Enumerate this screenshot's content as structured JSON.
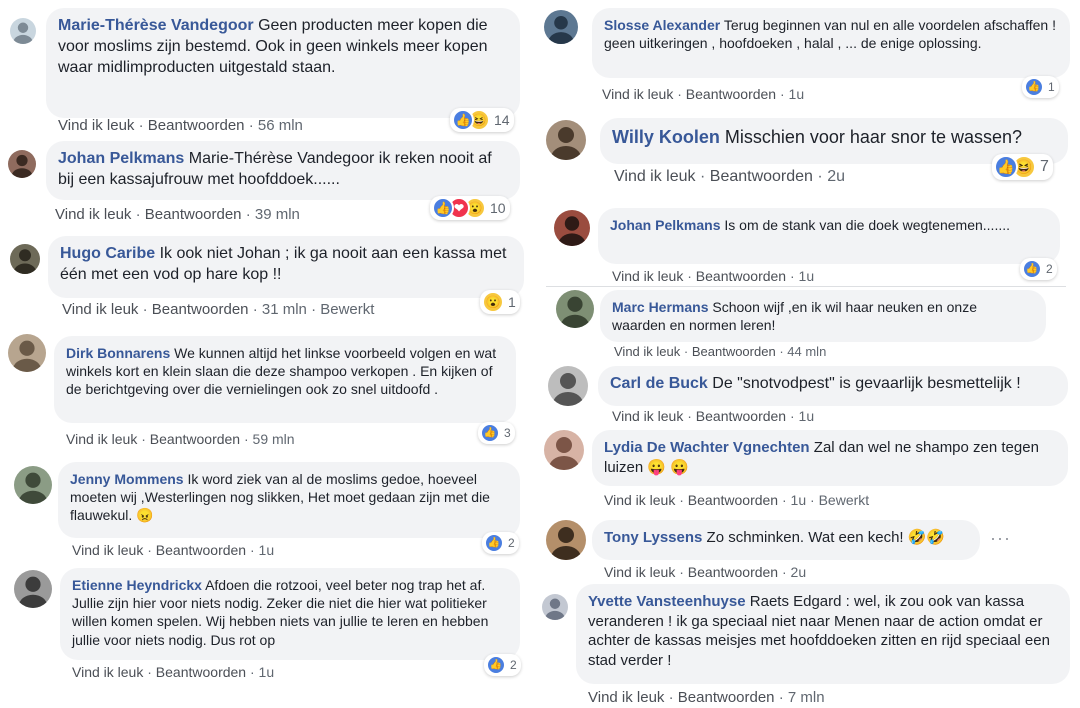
{
  "ui": {
    "like": "Vind ik leuk",
    "dot": "·",
    "reply": "Beantwoorden",
    "edited": "Bewerkt",
    "more": "···"
  },
  "comments": [
    {
      "name": "Marie-Thérèse Vandegoor",
      "text": "Geen producten meer kopen die voor moslims zijn bestemd. Ook in geen winkels meer kopen waar midlimproducten uitgestald staan.",
      "time": "56 mln",
      "reactions": [
        "like",
        "laugh"
      ],
      "count": "14"
    },
    {
      "name": "Johan Pelkmans",
      "text": "Marie-Thérèse Vandegoor ik reken nooit af bij een kassajufrouw met hoofddoek......",
      "time": "39 mln",
      "reactions": [
        "like",
        "love",
        "wow"
      ],
      "count": "10"
    },
    {
      "name": "Hugo Caribe",
      "text": "Ik ook niet Johan ; ik ga nooit aan een kassa met één met een vod op hare kop !!",
      "time": "31 mln",
      "edited": true,
      "reactions": [
        "wow"
      ],
      "count": "1"
    },
    {
      "name": "Dirk Bonnarens",
      "text": "We kunnen altijd het linkse voorbeeld volgen en wat winkels kort en klein slaan die deze shampoo verkopen . En kijken of de berichtgeving over die vernielingen ook zo snel uitdoofd .",
      "time": "59 mln",
      "reactions": [
        "like"
      ],
      "count": "3"
    },
    {
      "name": "Jenny Mommens",
      "text": "Ik word ziek van al de moslims gedoe, hoeveel moeten wij ,Westerlingen nog slikken, Het moet gedaan zijn met die flauwekul.",
      "emoji": "😠",
      "time": "1u",
      "reactions": [
        "like"
      ],
      "count": "2"
    },
    {
      "name": "Etienne Heyndrickx",
      "text": "Afdoen die rotzooi, veel beter nog trap het af. Jullie zijn hier voor niets nodig. Zeker die niet die hier wat politieker willen komen spelen. Wij hebben niets van jullie te leren en hebben jullie voor niets nodig. Dus rot op",
      "time": "1u",
      "reactions": [
        "like"
      ],
      "count": "2"
    },
    {
      "name": "Slosse Alexander",
      "text": "Terug beginnen van nul en alle voordelen afschaffen ! geen uitkeringen , hoofdoeken , halal , ... de enige oplossing.",
      "time": "1u",
      "reactions": [
        "like"
      ],
      "count": "1"
    },
    {
      "name": "Willy Koolen",
      "text": "Misschien voor haar snor te wassen?",
      "time": "2u",
      "reactions": [
        "like",
        "laugh"
      ],
      "count": "7"
    },
    {
      "name": "Johan Pelkmans",
      "text": "Is om de stank van die doek wegtenemen.......",
      "time": "1u",
      "reactions": [
        "like"
      ],
      "count": "2"
    },
    {
      "name": "Marc Hermans",
      "text": "Schoon wijf ,en ik wil haar neuken en onze waarden en normen leren!",
      "time": "44 mln"
    },
    {
      "name": "Carl de Buck",
      "text": "De \"snotvodpest\" is gevaarlijk besmettelijk !",
      "time": "1u"
    },
    {
      "name": "Lydia De Wachter Vgnechten",
      "text": "Zal dan wel ne shampo zen tegen luizen",
      "emoji": "😛 😛",
      "time": "1u",
      "edited": true
    },
    {
      "name": "Tony Lyssens",
      "text": "Zo schminken. Wat een kech!",
      "emoji": "🤣🤣",
      "time": "2u"
    },
    {
      "name": "Yvette Vansteenhuyse",
      "text": "Raets Edgard : wel, ik zou ook van kassa veranderen ! ik ga speciaal niet naar Menen naar de action omdat er achter de kassas meisjes met hoofddoeken zitten en rijd speciaal een stad verder !",
      "time": "7 mln"
    }
  ],
  "colors": {
    "bubble": "#f2f3f5",
    "name": "#385898",
    "meta": "#606770",
    "like": "#4a7ee0",
    "love": "#f0334e",
    "emoji": "#f7c83e"
  }
}
